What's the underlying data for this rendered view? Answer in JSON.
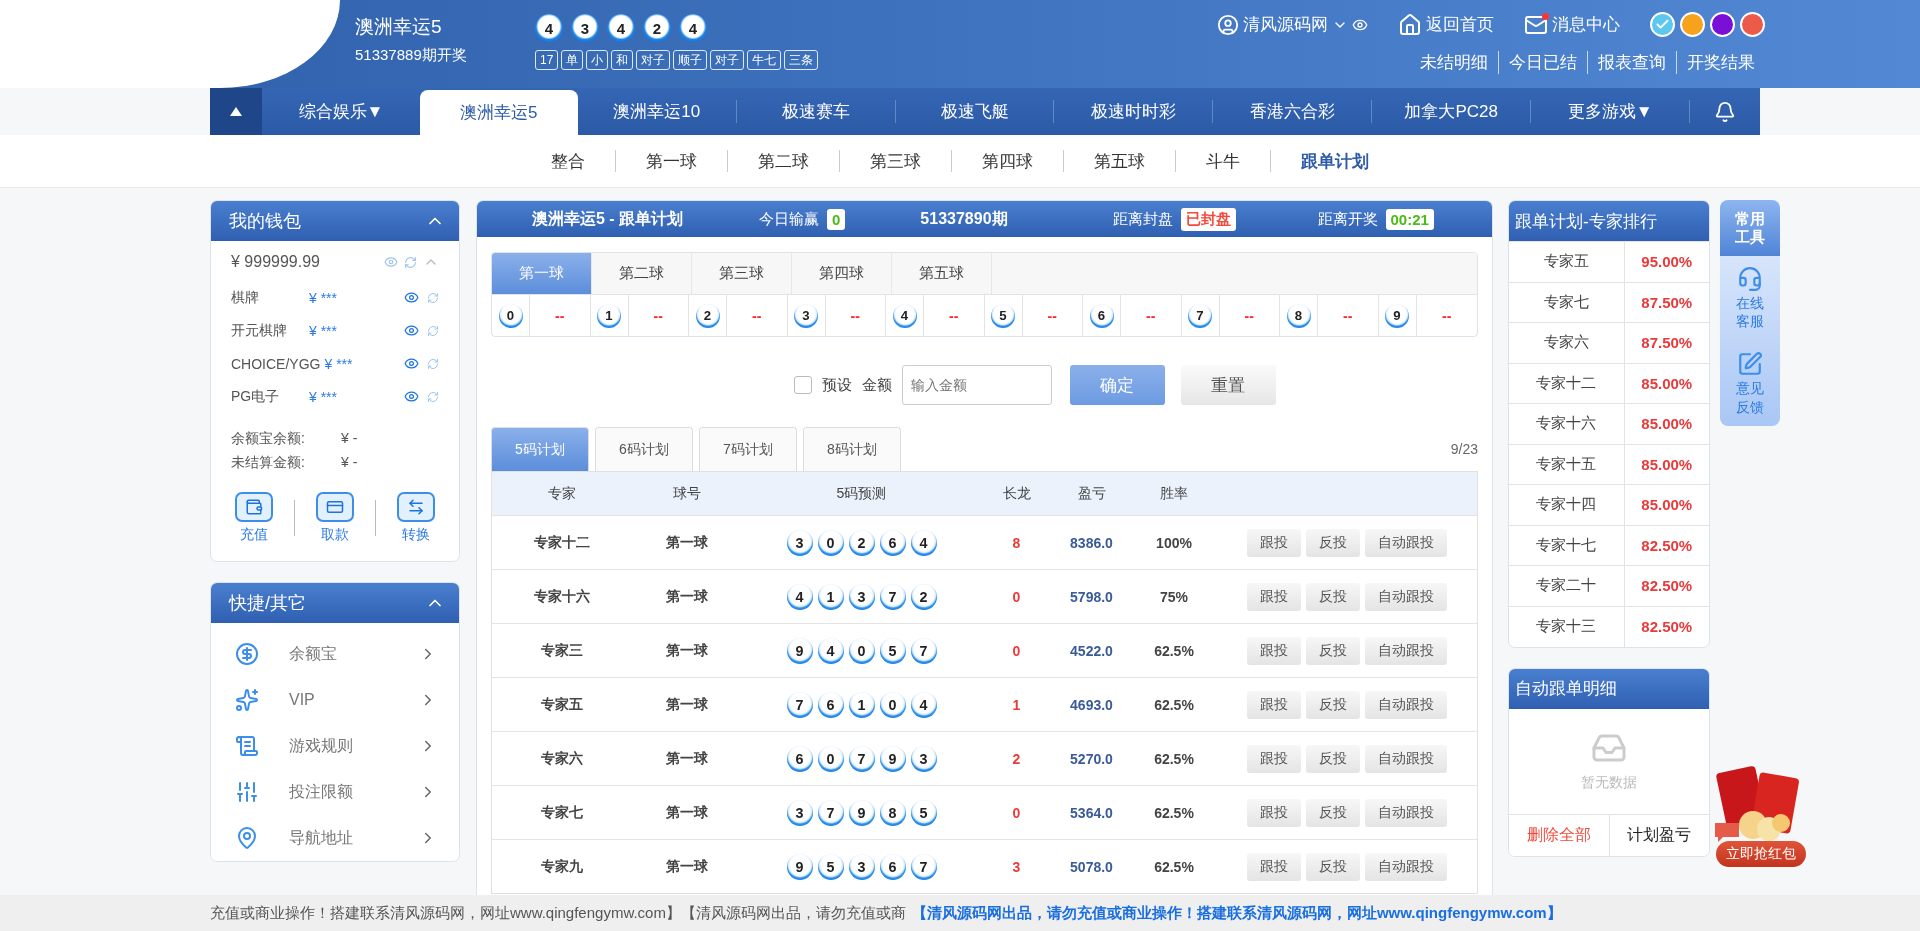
{
  "header": {
    "lottery_name": "澳洲幸运5",
    "draw_label": "51337889期开奖",
    "balls": [
      "4",
      "3",
      "4",
      "2",
      "4"
    ],
    "tags": [
      "17",
      "单",
      "小",
      "和",
      "对子",
      "顺子",
      "对子",
      "牛七",
      "三条"
    ],
    "user": {
      "name": "清风源码网"
    },
    "links": [
      {
        "label": "返回首页",
        "kind": "home",
        "badge": false
      },
      {
        "label": "消息中心",
        "kind": "mail",
        "badge": true
      }
    ],
    "themes": [
      {
        "color": "#5cc8f0",
        "selected": true
      },
      {
        "color": "#f7a21b",
        "selected": false
      },
      {
        "color": "#7a10d8",
        "selected": false
      },
      {
        "color": "#ec5a4a",
        "selected": false
      }
    ],
    "sub_links": [
      "未结明细",
      "今日已结",
      "报表查询",
      "开奖结果"
    ]
  },
  "nav": {
    "items": [
      {
        "label": "综合娱乐▼",
        "selected": false
      },
      {
        "label": "澳洲幸运5",
        "selected": true
      },
      {
        "label": "澳洲幸运10",
        "selected": false
      },
      {
        "label": "极速赛车",
        "selected": false
      },
      {
        "label": "极速飞艇",
        "selected": false
      },
      {
        "label": "极速时时彩",
        "selected": false
      },
      {
        "label": "香港六合彩",
        "selected": false
      },
      {
        "label": "加拿大PC28",
        "selected": false
      },
      {
        "label": "更多游戏▼",
        "selected": false
      }
    ]
  },
  "subnav": {
    "items": [
      {
        "label": "整合",
        "selected": false
      },
      {
        "label": "第一球",
        "selected": false
      },
      {
        "label": "第二球",
        "selected": false
      },
      {
        "label": "第三球",
        "selected": false
      },
      {
        "label": "第四球",
        "selected": false
      },
      {
        "label": "第五球",
        "selected": false
      },
      {
        "label": "斗牛",
        "selected": false
      },
      {
        "label": "跟单计划",
        "selected": true
      }
    ]
  },
  "wallet": {
    "title": "我的钱包",
    "balance": "¥ 999999.99",
    "accounts": [
      {
        "name": "棋牌",
        "amount": "¥ ***"
      },
      {
        "name": "开元棋牌",
        "amount": "¥ ***"
      },
      {
        "name": "CHOICE/YGG",
        "amount": "¥ ***"
      },
      {
        "name": "PG电子",
        "amount": "¥ ***"
      }
    ],
    "summary": [
      {
        "label": "余额宝余额:",
        "value": "¥ -"
      },
      {
        "label": "未结算金额:",
        "value": "¥ -"
      }
    ],
    "actions": [
      "充值",
      "取款",
      "转换"
    ]
  },
  "shortcuts": {
    "title": "快捷/其它",
    "items": [
      "余额宝",
      "VIP",
      "游戏规则",
      "投注限额",
      "导航地址"
    ]
  },
  "plan": {
    "title": "澳洲幸运5 - 跟单计划",
    "today_label": "今日输赢",
    "today_value": "0",
    "period": "51337890期",
    "close_label": "距离封盘",
    "close_value": "已封盘",
    "draw_label": "距离开奖",
    "countdown": "00:21",
    "ball_tabs": [
      {
        "label": "第一球",
        "selected": true
      },
      {
        "label": "第二球",
        "selected": false
      },
      {
        "label": "第三球",
        "selected": false
      },
      {
        "label": "第四球",
        "selected": false
      },
      {
        "label": "第五球",
        "selected": false
      }
    ],
    "stats": [
      {
        "number": "0",
        "value": "--"
      },
      {
        "number": "1",
        "value": "--"
      },
      {
        "number": "2",
        "value": "--"
      },
      {
        "number": "3",
        "value": "--"
      },
      {
        "number": "4",
        "value": "--"
      },
      {
        "number": "5",
        "value": "--"
      },
      {
        "number": "6",
        "value": "--"
      },
      {
        "number": "7",
        "value": "--"
      },
      {
        "number": "8",
        "value": "--"
      },
      {
        "number": "9",
        "value": "--"
      }
    ],
    "form": {
      "preset_label": "预设",
      "preset_checked": false,
      "amount_label": "金额",
      "placeholder": "输入金额",
      "confirm": "确定",
      "reset": "重置"
    },
    "plan_tabs": [
      {
        "label": "5码计划",
        "selected": true
      },
      {
        "label": "6码计划",
        "selected": false
      },
      {
        "label": "7码计划",
        "selected": false
      },
      {
        "label": "8码计划",
        "selected": false
      }
    ],
    "page_count": "9/23",
    "table": {
      "columns": [
        "专家",
        "球号",
        "5码预测",
        "长龙",
        "盈亏",
        "胜率"
      ],
      "rows": [
        {
          "expert": "专家十二",
          "ball": "第一球",
          "numbers": [
            "3",
            "0",
            "2",
            "6",
            "4"
          ],
          "streak": "8",
          "profit": "8386.0",
          "win_rate": "100%",
          "actions": [
            "跟投",
            "反投",
            "自动跟投"
          ]
        },
        {
          "expert": "专家十六",
          "ball": "第一球",
          "numbers": [
            "4",
            "1",
            "3",
            "7",
            "2"
          ],
          "streak": "0",
          "profit": "5798.0",
          "win_rate": "75%",
          "actions": [
            "跟投",
            "反投",
            "自动跟投"
          ]
        },
        {
          "expert": "专家三",
          "ball": "第一球",
          "numbers": [
            "9",
            "4",
            "0",
            "5",
            "7"
          ],
          "streak": "0",
          "profit": "4522.0",
          "win_rate": "62.5%",
          "actions": [
            "跟投",
            "反投",
            "自动跟投"
          ]
        },
        {
          "expert": "专家五",
          "ball": "第一球",
          "numbers": [
            "7",
            "6",
            "1",
            "0",
            "4"
          ],
          "streak": "1",
          "profit": "4693.0",
          "win_rate": "62.5%",
          "actions": [
            "跟投",
            "反投",
            "自动跟投"
          ]
        },
        {
          "expert": "专家六",
          "ball": "第一球",
          "numbers": [
            "6",
            "0",
            "7",
            "9",
            "3"
          ],
          "streak": "2",
          "profit": "5270.0",
          "win_rate": "62.5%",
          "actions": [
            "跟投",
            "反投",
            "自动跟投"
          ]
        },
        {
          "expert": "专家七",
          "ball": "第一球",
          "numbers": [
            "3",
            "7",
            "9",
            "8",
            "5"
          ],
          "streak": "0",
          "profit": "5364.0",
          "win_rate": "62.5%",
          "actions": [
            "跟投",
            "反投",
            "自动跟投"
          ]
        },
        {
          "expert": "专家九",
          "ball": "第一球",
          "numbers": [
            "9",
            "5",
            "3",
            "6",
            "7"
          ],
          "streak": "3",
          "profit": "5078.0",
          "win_rate": "62.5%",
          "actions": [
            "跟投",
            "反投",
            "自动跟投"
          ]
        }
      ]
    }
  },
  "ranking": {
    "title": "跟单计划-专家排行",
    "rows": [
      {
        "name": "专家五",
        "rate": "95.00%"
      },
      {
        "name": "专家七",
        "rate": "87.50%"
      },
      {
        "name": "专家六",
        "rate": "87.50%"
      },
      {
        "name": "专家十二",
        "rate": "85.00%"
      },
      {
        "name": "专家十六",
        "rate": "85.00%"
      },
      {
        "name": "专家十五",
        "rate": "85.00%"
      },
      {
        "name": "专家十四",
        "rate": "85.00%"
      },
      {
        "name": "专家十七",
        "rate": "82.50%"
      },
      {
        "name": "专家二十",
        "rate": "82.50%"
      },
      {
        "name": "专家十三",
        "rate": "82.50%"
      }
    ]
  },
  "auto_detail": {
    "title": "自动跟单明细",
    "empty_text": "暂无数据",
    "delete_all": "删除全部",
    "plan_profit": "计划盈亏"
  },
  "tools": {
    "title": "常用工具",
    "items": [
      "在线客服",
      "意见反馈"
    ]
  },
  "promo": {
    "label": "立即抢红包"
  },
  "ticker": {
    "text": "充值或商业操作！搭建联系清风源码网，网址www.qingfengymw.com】【清风源码网出品，请勿充值或商",
    "highlight": "【清风源码网出品，请勿充值或商业操作！搭建联系清风源码网，网址www.qingfengymw.com】"
  }
}
